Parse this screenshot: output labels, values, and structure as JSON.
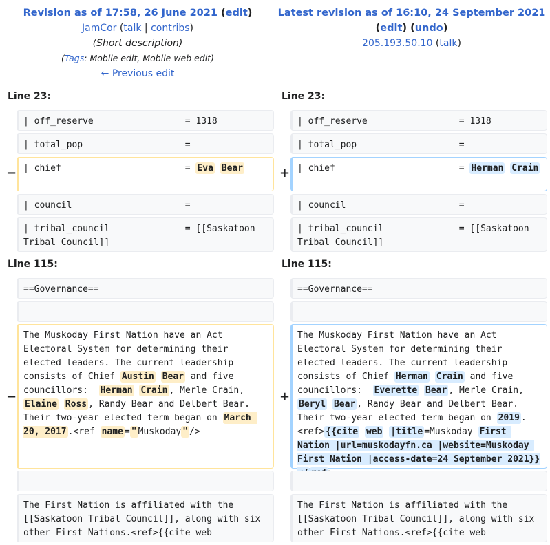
{
  "header_left": {
    "title_prefix": "Revision as of 17:58, 26 June 2021",
    "edit": "edit",
    "user": "JamCor",
    "talk": "talk",
    "contribs": "contribs",
    "summary": "(Short description)",
    "tags_label": "Tags",
    "tags_value": ": Mobile edit, Mobile web edit)",
    "previous_edit": "← Previous edit"
  },
  "header_right": {
    "title": "Latest revision as of 16:10, 24 September 2021",
    "edit": "edit",
    "undo": "undo",
    "ip": "205.193.50.10",
    "talk": "talk"
  },
  "colors": {
    "deleted": "#ffe49c",
    "added": "#a3d3ff",
    "deleted_hl": "#feeec8",
    "added_hl": "#d8ecff",
    "link": "#3366cc"
  },
  "markers": {
    "minus": "−",
    "plus": "+"
  },
  "diff": {
    "hunk1_label": "Line 23:",
    "hunk2_label": "Line 115:",
    "off_reserve": "| off_reserve                 = 1318",
    "total_pop": "| total_pop                   =",
    "chief_prefix": "| chief                       = ",
    "chief_old": [
      "Eva",
      "Bear"
    ],
    "chief_new": [
      "Herman",
      "Crain"
    ],
    "council": "| council                     =",
    "tribal_council": "| tribal_council              = [[Saskatoon Tribal Council]]",
    "governance": "==Governance==",
    "para_prefix": "The Muskoday First Nation have an Act Electoral System for determining their elected leaders. The current leadership consists of Chief ",
    "para_mid1": " and five councillors:  ",
    "para_mid2": ", Merle Crain, ",
    "para_mid3": ", Randy Bear and Delbert Bear. Their two-year elected term began on ",
    "old": {
      "chief": [
        "Austin",
        "Bear"
      ],
      "c1": [
        "Herman",
        "Crain"
      ],
      "c2": [
        "Elaine",
        "Ross"
      ],
      "date": "March 20, 2017",
      "ref_open": ".<ref ",
      "ref_name": "name",
      "ref_eq": "=",
      "ref_q1": "\"",
      "ref_val": "Muskoday",
      "ref_q2": "\"",
      "ref_close": "/>"
    },
    "new": {
      "chief": [
        "Herman",
        "Crain"
      ],
      "c1": [
        "Everette",
        "Bear"
      ],
      "c2": [
        "Beryl",
        "Bear"
      ],
      "date": "2019",
      "ref_open": ". <ref>",
      "cite": "{{cite",
      "web": "web",
      "title_kw": "|title",
      "title_eq": "=Muskoday ",
      "rest": "First Nation |url=muskodayfn.ca |website=Muskoday First Nation |access-date=24 September 2021}}</",
      "ref_tag": "ref",
      "gt": ">"
    },
    "affiliated": "The First Nation is affiliated with the [[Saskatoon Tribal Council]], along with six other First Nations.<ref>{{cite web"
  }
}
